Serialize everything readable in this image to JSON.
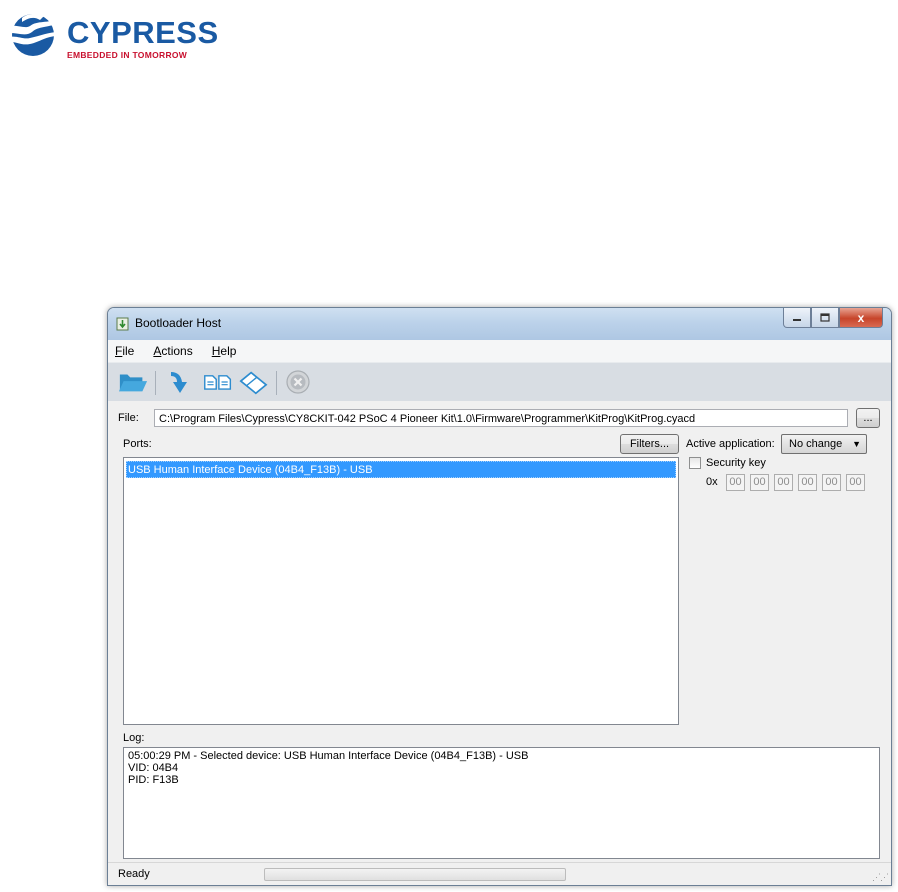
{
  "logo": {
    "name": "CYPRESS",
    "tagline": "EMBEDDED IN TOMORROW"
  },
  "window": {
    "title": "Bootloader Host",
    "controls": {
      "minimize": "_",
      "maximize": "□",
      "close": "x"
    }
  },
  "menu": [
    {
      "label": "File",
      "mnemonic": "F",
      "rest": "ile"
    },
    {
      "label": "Actions",
      "mnemonic": "A",
      "rest": "ctions"
    },
    {
      "label": "Help",
      "mnemonic": "H",
      "rest": "elp"
    }
  ],
  "toolbar": {
    "icons": [
      "folder-open-icon",
      "program-icon",
      "verify-icon",
      "erase-icon",
      "abort-icon"
    ]
  },
  "file": {
    "label": "File:",
    "path": "C:\\Program Files\\Cypress\\CY8CKIT-042 PSoC 4 Pioneer Kit\\1.0\\Firmware\\Programmer\\KitProg\\KitProg.cyacd",
    "browse_label": "..."
  },
  "ports": {
    "label": "Ports:",
    "filters_label": "Filters...",
    "items": [
      "USB Human Interface Device (04B4_F13B) - USB"
    ],
    "selected_index": 0
  },
  "options": {
    "active_app_label": "Active application:",
    "active_app_value": "No change",
    "security_key_label": "Security key",
    "security_key_checked": false,
    "key_prefix": "0x",
    "key_bytes": [
      "00",
      "00",
      "00",
      "00",
      "00",
      "00"
    ]
  },
  "log": {
    "label": "Log:",
    "lines": [
      "05:00:29 PM - Selected device: USB Human Interface Device (04B4_F13B) - USB",
      "VID: 04B4",
      "PID: F13B"
    ]
  },
  "status": {
    "text": "Ready",
    "progress": 0
  },
  "colors": {
    "selection": "#3399ff",
    "logo_blue": "#1a5aa3",
    "logo_red": "#c8102e"
  }
}
